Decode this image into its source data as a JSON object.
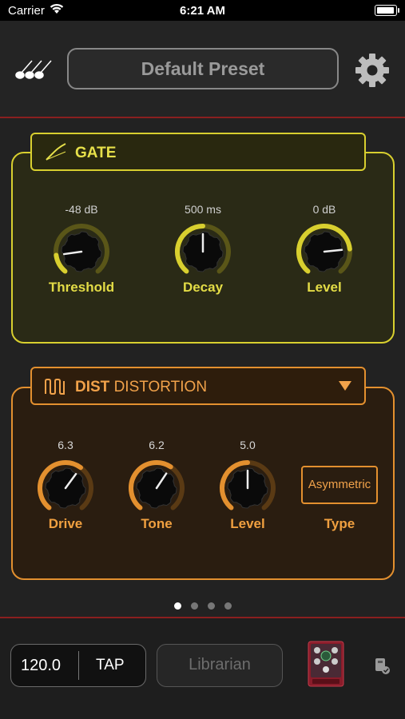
{
  "status_bar": {
    "carrier": "Carrier",
    "time": "6:21 AM"
  },
  "header": {
    "preset_name": "Default Preset"
  },
  "gate": {
    "title": "GATE",
    "knobs": [
      {
        "value": "-48 dB",
        "label": "Threshold",
        "level": 0.15
      },
      {
        "value": "500 ms",
        "label": "Decay",
        "level": 0.5
      },
      {
        "value": "0 dB",
        "label": "Level",
        "level": 0.8
      }
    ]
  },
  "dist": {
    "category": "DIST",
    "name": "DISTORTION",
    "knobs": [
      {
        "value": "6.3",
        "label": "Drive",
        "level": 0.63
      },
      {
        "value": "6.2",
        "label": "Tone",
        "level": 0.62
      },
      {
        "value": "5.0",
        "label": "Level",
        "level": 0.5
      }
    ],
    "type": {
      "value": "Asymmetric",
      "label": "Type"
    }
  },
  "pager": {
    "count": 4,
    "active": 0
  },
  "footer": {
    "tempo": "120.0",
    "tap_label": "TAP",
    "librarian_label": "Librarian"
  },
  "colors": {
    "gate_accent": "#d8cf2f",
    "dist_accent": "#e3902f",
    "divider": "#8a1f1f"
  },
  "icons": [
    "wifi-icon",
    "battery-icon",
    "guitars-icon",
    "gear-icon",
    "gate-icon",
    "distortion-wave-icon",
    "dropdown-arrow-icon",
    "pedal-thumbnail",
    "device-check-icon"
  ]
}
